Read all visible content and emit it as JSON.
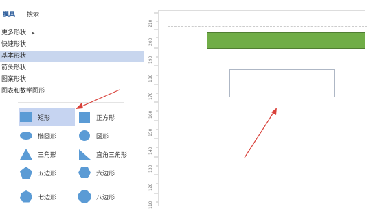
{
  "panel": {
    "tabs": [
      {
        "label": "模具",
        "active": true
      },
      {
        "label": "搜索",
        "active": false
      }
    ],
    "categories": [
      {
        "label": "更多形状",
        "has_submenu": true
      },
      {
        "label": "快速形状"
      },
      {
        "label": "基本形状",
        "selected": true
      },
      {
        "label": "箭头形状"
      },
      {
        "label": "图案形状"
      },
      {
        "label": "图表和数学图形"
      }
    ],
    "shapes": [
      {
        "label": "矩形",
        "icon": "rectangle-icon",
        "selected": true
      },
      {
        "label": "正方形",
        "icon": "square-icon"
      },
      {
        "label": "椭圆形",
        "icon": "ellipse-icon"
      },
      {
        "label": "圆形",
        "icon": "circle-icon"
      },
      {
        "label": "三角形",
        "icon": "triangle-icon"
      },
      {
        "label": "直角三角形",
        "icon": "right-triangle-icon"
      },
      {
        "label": "五边形",
        "icon": "pentagon-icon"
      },
      {
        "label": "六边形",
        "icon": "hexagon-icon"
      },
      {
        "label": "七边形",
        "icon": "heptagon-icon"
      },
      {
        "label": "八边形",
        "icon": "octagon-icon"
      }
    ]
  },
  "ruler": {
    "ticks": [
      "210",
      "200",
      "190",
      "180",
      "170",
      "160",
      "150",
      "140",
      "130",
      "120",
      "110"
    ]
  },
  "colors": {
    "shape_blue": "#5b9bd5",
    "selection": "#c6d4f1",
    "green_shape": "#70ad47",
    "arrow_red": "#d9413a"
  }
}
